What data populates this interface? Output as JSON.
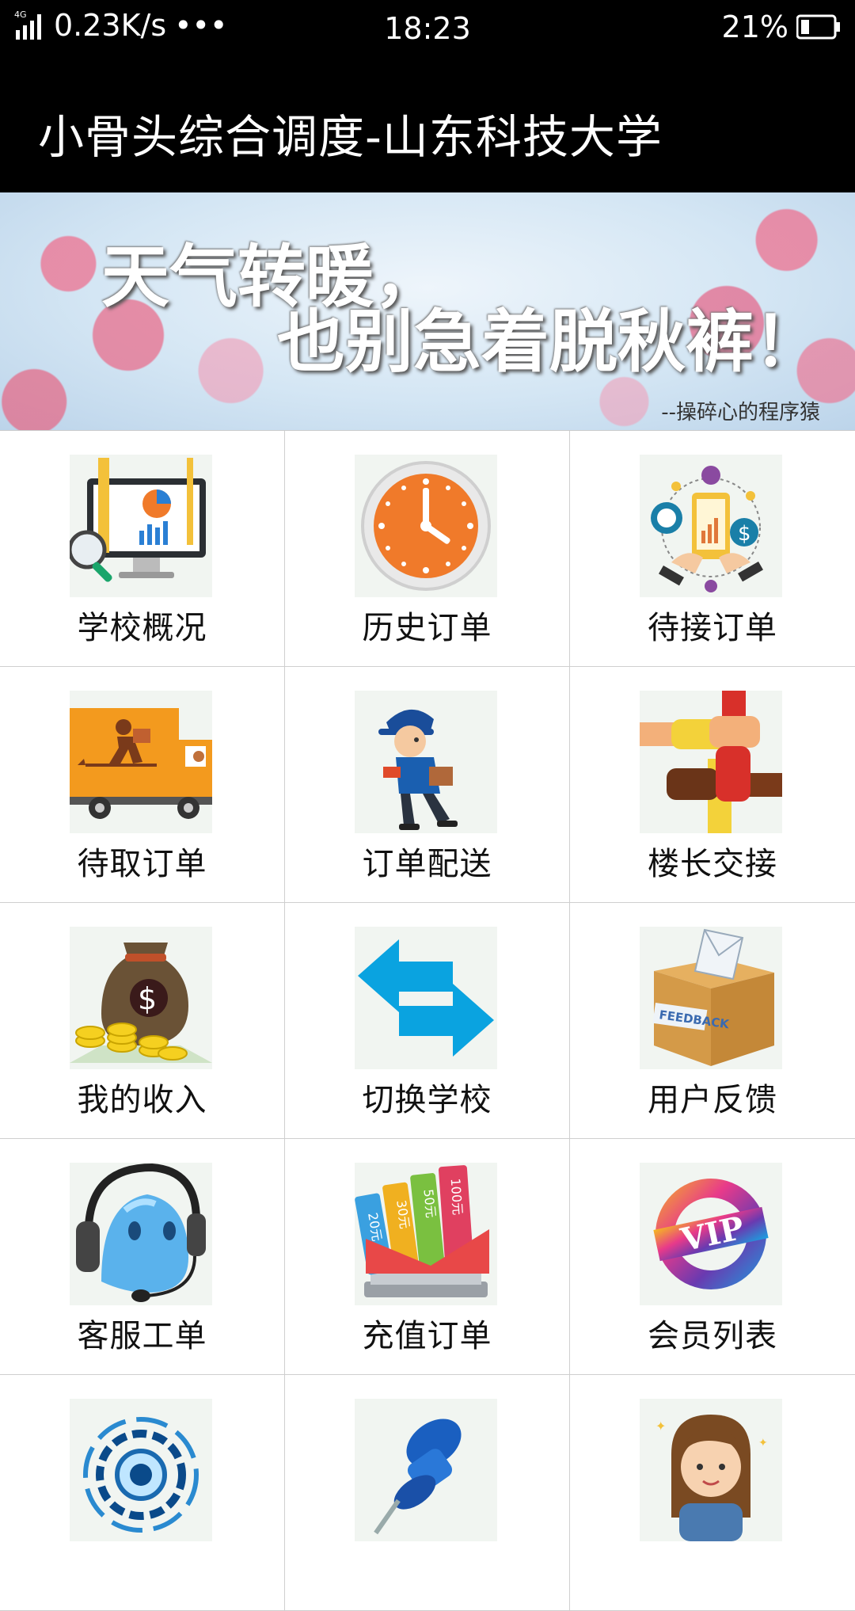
{
  "status_bar": {
    "network": "4G",
    "speed": "0.23K/s",
    "more": "•••",
    "time": "18:23",
    "battery": "21%"
  },
  "app_bar": {
    "title": "小骨头综合调度-山东科技大学"
  },
  "banner": {
    "line1": "天气转暖，",
    "line2": "也别急着脱秋裤！",
    "signature": "--操碎心的程序猿"
  },
  "menu": [
    {
      "label": "学校概况",
      "icon": "school-overview-icon"
    },
    {
      "label": "历史订单",
      "icon": "clock-icon"
    },
    {
      "label": "待接订单",
      "icon": "phone-payment-icon"
    },
    {
      "label": "待取订单",
      "icon": "delivery-truck-icon"
    },
    {
      "label": "订单配送",
      "icon": "courier-icon"
    },
    {
      "label": "楼长交接",
      "icon": "hands-teamwork-icon"
    },
    {
      "label": "我的收入",
      "icon": "money-bag-icon"
    },
    {
      "label": "切换学校",
      "icon": "switch-arrows-icon"
    },
    {
      "label": "用户反馈",
      "icon": "feedback-box-icon"
    },
    {
      "label": "客服工单",
      "icon": "customer-service-icon"
    },
    {
      "label": "充值订单",
      "icon": "recharge-cards-icon"
    },
    {
      "label": "会员列表",
      "icon": "vip-icon"
    },
    {
      "label": "",
      "icon": "gear-tech-icon"
    },
    {
      "label": "",
      "icon": "pushpin-icon"
    },
    {
      "label": "",
      "icon": "woman-avatar-icon"
    }
  ],
  "recharge_cards": [
    "20元",
    "30元",
    "50元",
    "100元"
  ],
  "feedback_text": "FEEDBACK",
  "vip_text": "VIP",
  "colors": {
    "bar_background": "#000000",
    "clock_orange": "#f07a2a",
    "arrow_blue": "#0aa3e0"
  }
}
